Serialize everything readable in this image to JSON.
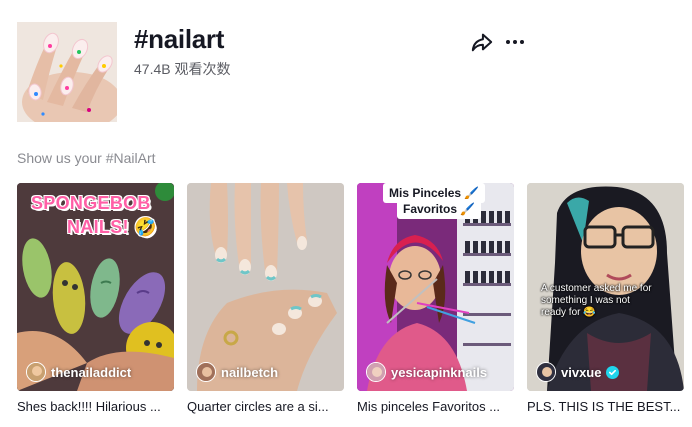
{
  "hashtag": {
    "title": "#nailart",
    "views": "47.4B 观看次数"
  },
  "actions": {
    "share_icon": "share-icon",
    "more_icon": "more-icon"
  },
  "section": {
    "label": "Show us your #NailArt"
  },
  "videos": [
    {
      "author": "thenailaddict",
      "caption": "Shes back!!!! Hilarious ...",
      "overlay": "SPONGEBOB NAILS! 🤣",
      "overlay_line1": "SPONGEBOB",
      "overlay_line2": "NAILS! 🤣",
      "verified": false
    },
    {
      "author": "nailbetch",
      "caption": "Quarter circles are a si...",
      "verified": false
    },
    {
      "author": "yesicapinknails",
      "caption": "Mis pinceles Favoritos ...",
      "overlay_line1": "Mis Pinceles 🖌️",
      "overlay_line2": "Favoritos 🖌️",
      "verified": false
    },
    {
      "author": "vivxue",
      "caption": "PLS. THIS IS THE BEST...",
      "overlay_line1": "A customer asked me for",
      "overlay_line2": "something I was not",
      "overlay_line3": "ready for 😂",
      "verified": true
    }
  ],
  "colors": {
    "accent_verified": "#20d5ec",
    "text_primary": "#161823",
    "text_secondary": "#8a8b91"
  }
}
